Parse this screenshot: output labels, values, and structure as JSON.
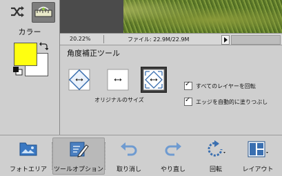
{
  "colors": {
    "foreground": "#ffff10",
    "background": "#ffffff",
    "panel": "#cfcfcf",
    "accent_blue": "#3a6fb0"
  },
  "left_panel": {
    "color_label": "カラー",
    "tools": [
      {
        "icon": "shuffle-icon"
      },
      {
        "icon": "straighten-tool-icon",
        "selected": true
      }
    ]
  },
  "status_bar": {
    "zoom": "20.22%",
    "file_size": "ファイル: 22.9M/22.9M"
  },
  "options_panel": {
    "title": "角度補正ツール",
    "original_size_label": "オリジナルのサイズ",
    "checkboxes": [
      {
        "label": "すべてのレイヤーを回転",
        "checked": true
      },
      {
        "label": "エッジを自動的に塗りつぶし",
        "checked": true
      }
    ]
  },
  "bottom_bar": {
    "photo_area": "フォトエリア",
    "tool_options": "ツールオプション",
    "undo": "取り消し",
    "redo": "やり直し",
    "rotate": "回転",
    "layout": "レイアウト"
  }
}
